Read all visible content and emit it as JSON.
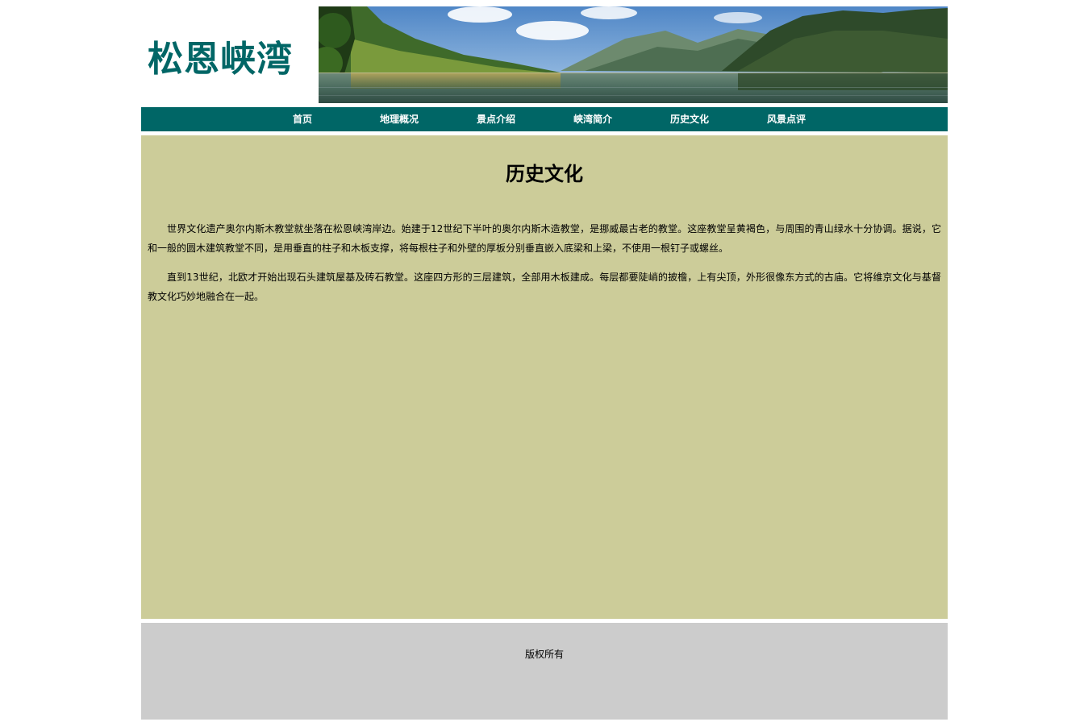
{
  "header": {
    "site_title": "松恩峡湾",
    "banner_image": "fjord-landscape-image"
  },
  "nav": {
    "items": [
      {
        "label": "首页"
      },
      {
        "label": "地理概况"
      },
      {
        "label": "景点介绍"
      },
      {
        "label": "峡湾简介"
      },
      {
        "label": "历史文化"
      },
      {
        "label": "风景点评"
      }
    ]
  },
  "main": {
    "title": "历史文化",
    "paragraphs": [
      "世界文化遗产奥尔内斯木教堂就坐落在松恩峡湾岸边。始建于12世纪下半叶的奥尔内斯木造教堂，是挪威最古老的教堂。这座教堂呈黄褐色，与周围的青山绿水十分协调。据说，它和一般的圆木建筑教堂不同，是用垂直的柱子和木板支撑，将每根柱子和外壁的厚板分别垂直嵌入底梁和上梁，不使用一根钉子或螺丝。",
      "直到13世纪，北欧才开始出现石头建筑屋基及砖石教堂。这座四方形的三层建筑，全部用木板建成。每层都要陡峭的披檐，上有尖顶，外形很像东方式的古庙。它将维京文化与基督教文化巧妙地融合在一起。"
    ]
  },
  "footer": {
    "copyright": "版权所有"
  },
  "colors": {
    "brand": "#006666",
    "content_bg": "#cccc99",
    "footer_bg": "#cccccc"
  }
}
